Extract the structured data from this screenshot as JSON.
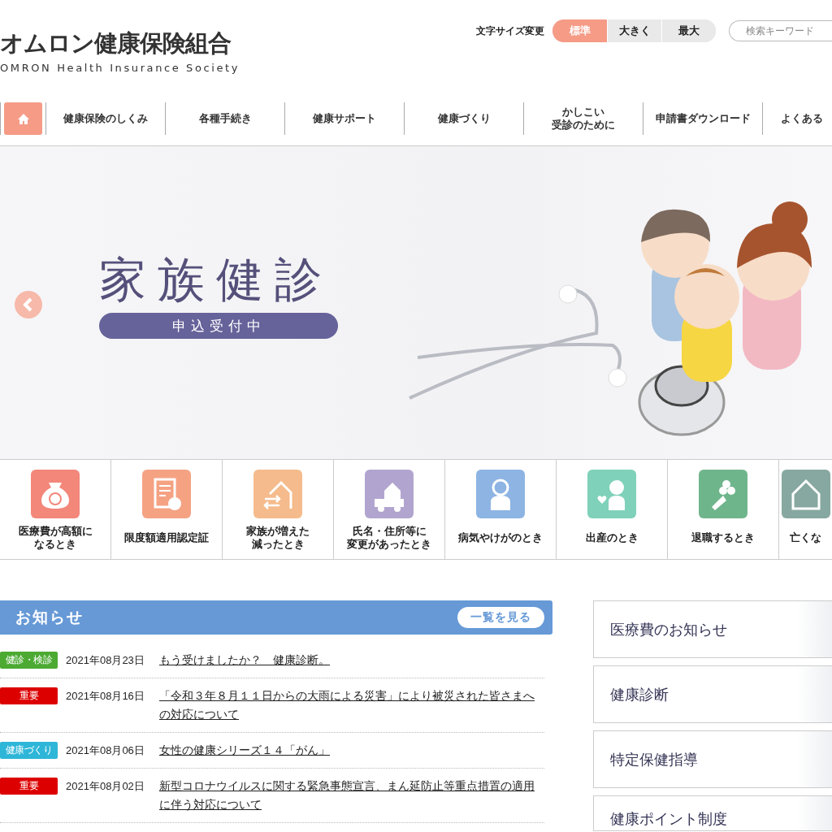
{
  "header": {
    "logo_title": "オムロン健康保険組合",
    "logo_subtitle": "OMRON Health Insurance Society",
    "font_size_label": "文字サイズ変更",
    "font_sizes": [
      {
        "label": "標準",
        "selected": true
      },
      {
        "label": "大きく",
        "selected": false
      },
      {
        "label": "最大",
        "selected": false
      }
    ],
    "search": {
      "placeholder": "検索キーワード"
    }
  },
  "nav": {
    "items": [
      {
        "lines": [
          "健康保険のしくみ"
        ]
      },
      {
        "lines": [
          "各種手続き"
        ]
      },
      {
        "lines": [
          "健康サポート"
        ]
      },
      {
        "lines": [
          "健康づくり"
        ]
      },
      {
        "lines": [
          "かしこい",
          "受診のために"
        ]
      },
      {
        "lines": [
          "申請書ダウンロード"
        ]
      },
      {
        "lines": [
          "よくある"
        ]
      }
    ]
  },
  "hero": {
    "title": "家族健診",
    "badge": "申込受付中"
  },
  "tiles": [
    {
      "lines": [
        "医療費が高額に",
        "なるとき"
      ],
      "color": "#f2877a"
    },
    {
      "lines": [
        "限度額適用認定証"
      ],
      "color": "#f5a283"
    },
    {
      "lines": [
        "家族が増えた",
        "減ったとき"
      ],
      "color": "#f5bb8c"
    },
    {
      "lines": [
        "氏名・住所等に",
        "変更があったとき"
      ],
      "color": "#b1a5cf"
    },
    {
      "lines": [
        "病気やけがのとき"
      ],
      "color": "#8db4e3"
    },
    {
      "lines": [
        "出産のとき"
      ],
      "color": "#7fd1b9"
    },
    {
      "lines": [
        "退職するとき"
      ],
      "color": "#6fb58c"
    },
    {
      "lines": [
        "亡くな"
      ],
      "color": "#86a8a0"
    }
  ],
  "news": {
    "title": "お知らせ",
    "more_button": "一覧を見る",
    "items": [
      {
        "tag": "健診・検診",
        "color": "#4caa32",
        "date": "2021年08月23日",
        "title": "もう受けましたか？　健康診断。"
      },
      {
        "tag": "重要",
        "color": "#dd0000",
        "date": "2021年08月16日",
        "title": "「令和３年８月１１日からの大雨による災害」により被災された皆さまへの対応について"
      },
      {
        "tag": "健康づくり",
        "color": "#2db6d8",
        "date": "2021年08月06日",
        "title": "女性の健康シリーズ１４「がん」"
      },
      {
        "tag": "重要",
        "color": "#dd0000",
        "date": "2021年08月02日",
        "title": "新型コロナウイルスに関する緊急事態宣言、まん延防止等重点措置の適用に伴う対応について"
      }
    ]
  },
  "side_links": [
    {
      "label": "医療費のお知らせ"
    },
    {
      "label": "健康診断"
    },
    {
      "label": "特定保健指導"
    },
    {
      "label": "健康ポイント制度"
    }
  ]
}
